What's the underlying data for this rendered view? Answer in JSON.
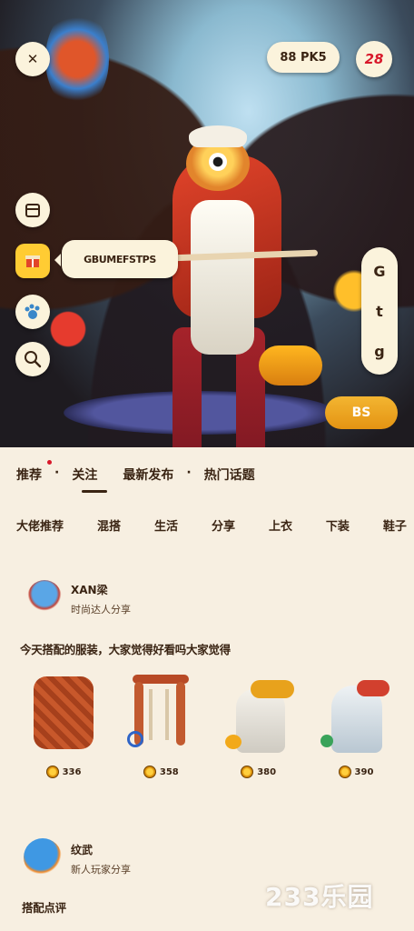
{
  "hero": {
    "close_label": "✕",
    "coins_label": "88 PK5",
    "badge_label": "28",
    "speech_text": "GBUMEFSTPS",
    "side_menu": [
      "G",
      "t",
      "g"
    ],
    "confirm_label": "BS"
  },
  "left_tools": [
    "shirt-icon",
    "gift-icon",
    "paw-icon",
    "search-icon"
  ],
  "tabs": [
    "推荐",
    "·",
    "关注",
    "最新发布",
    "·",
    "热门话题"
  ],
  "categories": [
    "大佬推荐",
    "混搭",
    "生活",
    "分享",
    "上衣",
    "下装",
    "鞋子"
  ],
  "post1": {
    "name": "XAN梁",
    "subtitle": "时尚达人分享",
    "text": "今天搭配的服装，大家觉得好看吗大家觉得"
  },
  "items": [
    {
      "price": "336",
      "name": "vest-item"
    },
    {
      "price": "358",
      "name": "harness-item"
    },
    {
      "price": "380",
      "name": "robe-item"
    },
    {
      "price": "390",
      "name": "cloak-item"
    }
  ],
  "post2": {
    "name": "纹武",
    "subtitle": "新人玩家分享",
    "text": "搭配点评"
  },
  "watermark": "233乐园",
  "colors": {
    "accent": "#e49413",
    "badge_red": "#d8182a",
    "text": "#3a2413",
    "panel_bg": "#f7efe1"
  }
}
